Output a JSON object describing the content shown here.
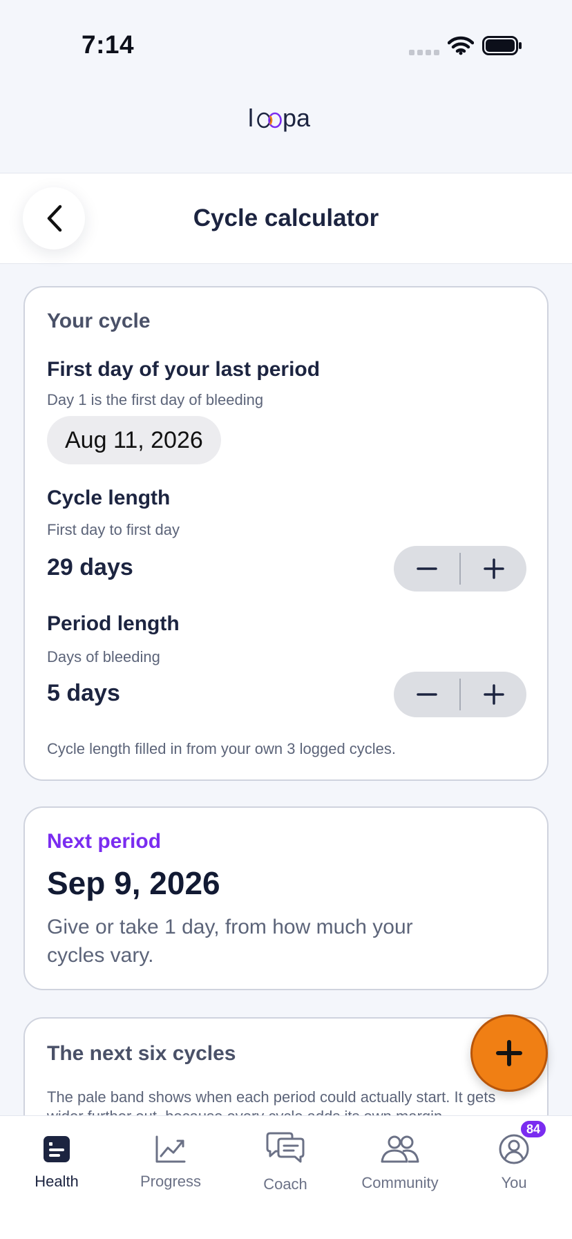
{
  "status_bar": {
    "time": "7:14"
  },
  "brand": {
    "name": "loopa"
  },
  "header": {
    "title": "Cycle calculator"
  },
  "your_cycle": {
    "section_title": "Your cycle",
    "last_period_label": "First day of your last period",
    "last_period_hint": "Day 1 is the first day of bleeding",
    "last_period_date": "Aug 11, 2026",
    "cycle_length_label": "Cycle length",
    "cycle_length_hint": "First day to first day",
    "cycle_length_value": "29 days",
    "period_length_label": "Period length",
    "period_length_hint": "Days of bleeding",
    "period_length_value": "5 days",
    "note": "Cycle length filled in from your own 3 logged cycles."
  },
  "next_period": {
    "label": "Next period",
    "date": "Sep 9, 2026",
    "description": "Give or take 1 day, from how much your cycles vary."
  },
  "next_six": {
    "title": "The next six cycles",
    "description": "The pale band shows when each period could actually start. It gets wider further out, because every cycle adds its own margin"
  },
  "tabs": [
    {
      "label": "Health",
      "icon": "health-icon"
    },
    {
      "label": "Progress",
      "icon": "progress-chart-icon"
    },
    {
      "label": "Coach",
      "icon": "chat-bubbles-icon"
    },
    {
      "label": "Community",
      "icon": "people-icon"
    },
    {
      "label": "You",
      "icon": "profile-icon",
      "badge": "84"
    }
  ],
  "colors": {
    "accent_purple": "#7a2cf0",
    "fab_orange": "#f07f14",
    "background": "#f4f6fb"
  }
}
